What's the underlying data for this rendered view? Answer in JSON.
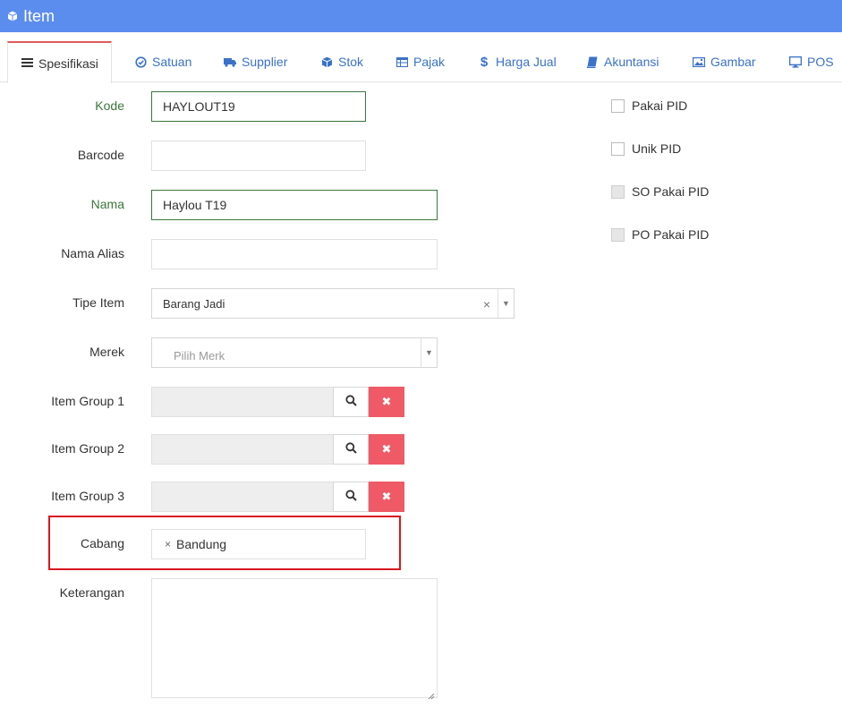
{
  "header": {
    "title": "Item",
    "icon": "cube-icon"
  },
  "tabs": [
    {
      "label": "Spesifikasi",
      "icon": "list-icon"
    },
    {
      "label": "Satuan",
      "icon": "check-circle-icon"
    },
    {
      "label": "Supplier",
      "icon": "truck-icon"
    },
    {
      "label": "Stok",
      "icon": "cube-icon"
    },
    {
      "label": "Pajak",
      "icon": "table-icon"
    },
    {
      "label": "Harga Jual",
      "icon": "dollar-icon"
    },
    {
      "label": "Akuntansi",
      "icon": "book-icon"
    },
    {
      "label": "Gambar",
      "icon": "image-icon"
    },
    {
      "label": "POS",
      "icon": "monitor-icon"
    }
  ],
  "form": {
    "kode": {
      "label": "Kode",
      "value": "HAYLOUT19"
    },
    "barcode": {
      "label": "Barcode",
      "value": ""
    },
    "nama": {
      "label": "Nama",
      "value": "Haylou T19"
    },
    "nama_alias": {
      "label": "Nama Alias",
      "value": ""
    },
    "tipe_item": {
      "label": "Tipe Item",
      "value": "Barang Jadi",
      "clear": "×",
      "arrow": "▼"
    },
    "merek": {
      "label": "Merek",
      "placeholder": "Pilih Merk",
      "arrow": "▼"
    },
    "item_group_1": {
      "label": "Item Group 1",
      "delete": "✖"
    },
    "item_group_2": {
      "label": "Item Group 2",
      "delete": "✖"
    },
    "item_group_3": {
      "label": "Item Group 3",
      "delete": "✖"
    },
    "cabang": {
      "label": "Cabang",
      "tag": "Bandung",
      "tag_remove": "×"
    },
    "keterangan": {
      "label": "Keterangan",
      "value": ""
    }
  },
  "checkboxes": [
    {
      "label": "Pakai PID",
      "enabled": true
    },
    {
      "label": "Unik PID",
      "enabled": true
    },
    {
      "label": "SO Pakai PID",
      "enabled": false
    },
    {
      "label": "PO Pakai PID",
      "enabled": false
    }
  ],
  "colors": {
    "header": "#5b8def",
    "tab_link": "#3a72c9",
    "active_tab_border": "#e05a5a",
    "success": "#3c763d",
    "delete_button": "#ef5a66",
    "highlight": "#d9161e"
  }
}
